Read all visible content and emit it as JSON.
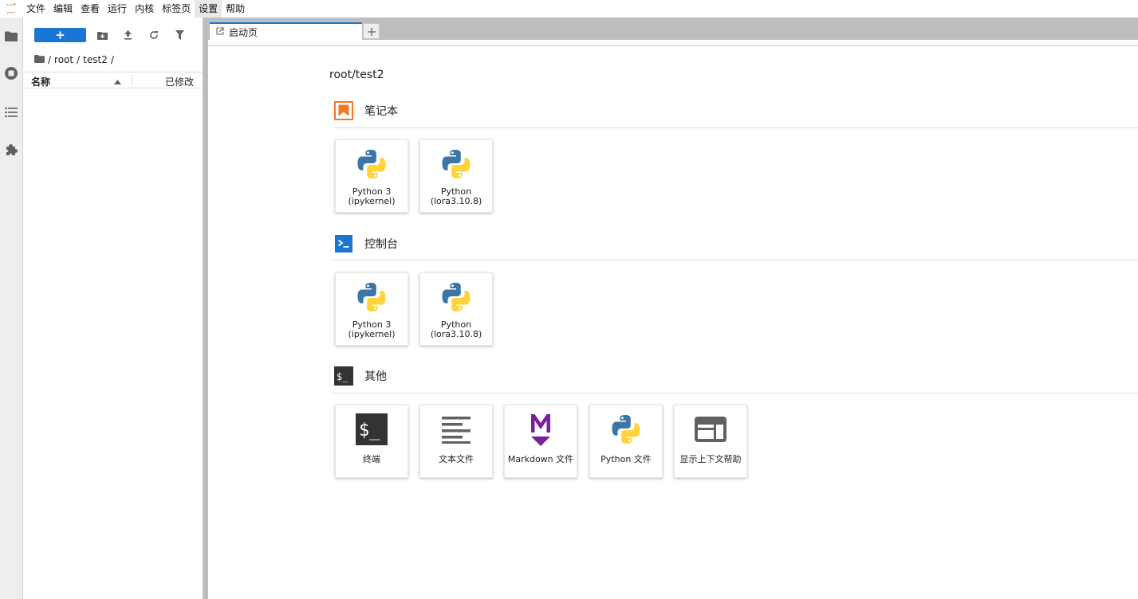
{
  "menubar": {
    "items": [
      "文件",
      "编辑",
      "查看",
      "运行",
      "内核",
      "标签页",
      "设置",
      "帮助"
    ],
    "active_index": 6
  },
  "activity_bar": {
    "items": [
      {
        "icon": "folder-icon",
        "active": true
      },
      {
        "icon": "running-sessions-icon",
        "active": false
      },
      {
        "icon": "table-of-contents-icon",
        "active": false
      },
      {
        "icon": "extension-puzzle-icon",
        "active": false
      }
    ]
  },
  "file_browser": {
    "new_button_label": "+",
    "toolbar_icons": [
      "new-folder-icon",
      "upload-icon",
      "refresh-icon",
      "filter-icon"
    ],
    "breadcrumb": [
      "/",
      "root",
      "/",
      "test2",
      "/"
    ],
    "columns": {
      "name": "名称",
      "modified": "已修改"
    }
  },
  "tabs": [
    {
      "label": "启动页",
      "active": true
    }
  ],
  "launcher": {
    "cwd": "root/test2",
    "sections": [
      {
        "title": "笔记本",
        "icon": "notebook-icon",
        "cards": [
          {
            "label": "Python 3 (ipykernel)",
            "icon": "python-icon"
          },
          {
            "label": "Python (lora3.10.8)",
            "icon": "python-icon"
          }
        ]
      },
      {
        "title": "控制台",
        "icon": "console-icon",
        "cards": [
          {
            "label": "Python 3 (ipykernel)",
            "icon": "python-icon"
          },
          {
            "label": "Python (lora3.10.8)",
            "icon": "python-icon"
          }
        ]
      },
      {
        "title": "其他",
        "icon": "other-terminal-icon",
        "cards": [
          {
            "label": "终端",
            "icon": "terminal-icon"
          },
          {
            "label": "文本文件",
            "icon": "text-file-icon"
          },
          {
            "label": "Markdown 文件",
            "icon": "markdown-icon"
          },
          {
            "label": "Python 文件",
            "icon": "python-icon"
          },
          {
            "label": "显示上下文帮助",
            "icon": "context-help-icon"
          }
        ]
      }
    ]
  },
  "colors": {
    "accent": "#1976d2",
    "notebook_orange": "#f37726",
    "console_blue": "#0d47a1",
    "markdown_purple": "#7b1fa2",
    "python_blue": "#3e75a8",
    "python_yellow": "#ffd43b"
  }
}
